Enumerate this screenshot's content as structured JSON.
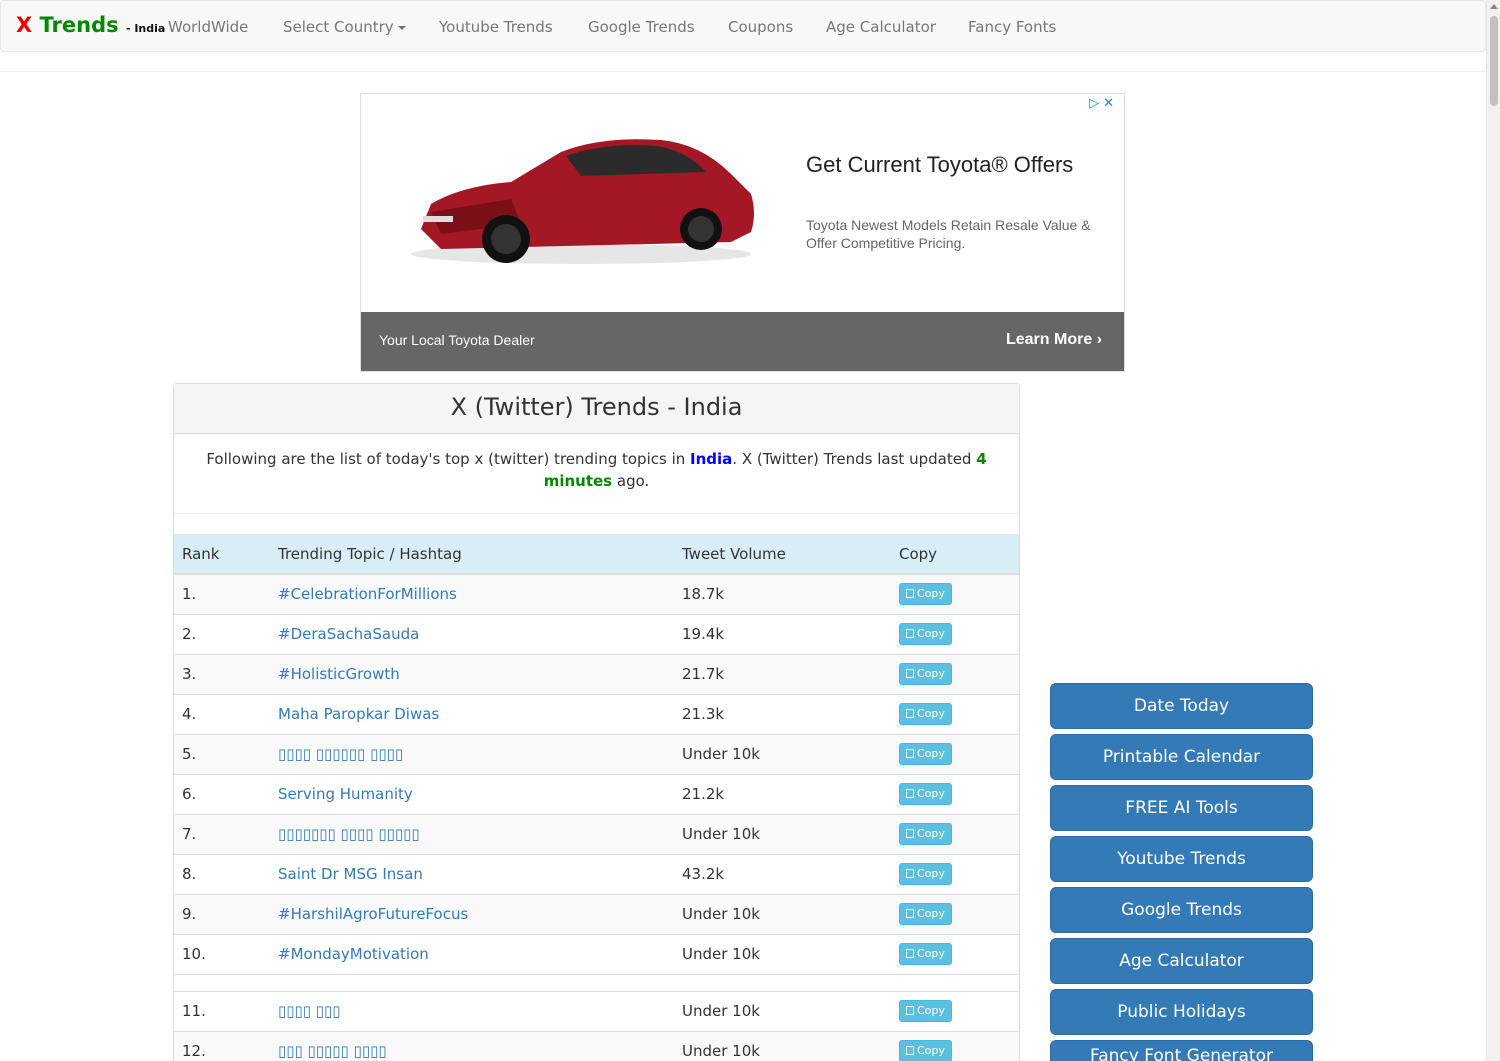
{
  "navbar": {
    "brand_x": "X",
    "brand_trends": "Trends",
    "brand_country": "- India",
    "items": [
      "WorldWide",
      "Select Country",
      "Youtube Trends",
      "Google Trends",
      "Coupons",
      "Age Calculator",
      "Fancy Fonts"
    ]
  },
  "ad": {
    "title": "Get Current Toyota® Offers",
    "description": "Toyota Newest Models Retain Resale Value & Offer Competitive Pricing.",
    "dealer": "Your Local Toyota Dealer",
    "cta": "Learn More"
  },
  "panel": {
    "title": "X (Twitter) Trends - India",
    "desc_before": "Following are the list of today's top x (twitter) trending topics in ",
    "desc_country": "India",
    "desc_middle": ". X (Twitter) Trends last updated ",
    "desc_time": "4 minutes",
    "desc_after": " ago."
  },
  "table": {
    "headers": [
      "Rank",
      "Trending Topic / Hashtag",
      "Tweet Volume",
      "Copy"
    ],
    "copy_label": "Copy",
    "rows": [
      {
        "rank": "1.",
        "topic": "#CelebrationForMillions",
        "volume": "18.7k"
      },
      {
        "rank": "2.",
        "topic": "#DeraSachaSauda",
        "volume": "19.4k"
      },
      {
        "rank": "3.",
        "topic": "#HolisticGrowth",
        "volume": "21.7k"
      },
      {
        "rank": "4.",
        "topic": "Maha Paropkar Diwas",
        "volume": "21.3k"
      },
      {
        "rank": "5.",
        "topic": "▯▯▯▯ ▯▯▯▯▯▯ ▯▯▯▯",
        "volume": "Under 10k"
      },
      {
        "rank": "6.",
        "topic": "Serving Humanity",
        "volume": "21.2k"
      },
      {
        "rank": "7.",
        "topic": "▯▯▯▯▯▯▯ ▯▯▯▯ ▯▯▯▯▯",
        "volume": "Under 10k"
      },
      {
        "rank": "8.",
        "topic": "Saint Dr MSG Insan",
        "volume": "43.2k"
      },
      {
        "rank": "9.",
        "topic": "#HarshilAgroFutureFocus",
        "volume": "Under 10k"
      },
      {
        "rank": "10.",
        "topic": "#MondayMotivation",
        "volume": "Under 10k"
      },
      {
        "rank": "11.",
        "topic": "▯▯▯▯ ▯▯▯",
        "volume": "Under 10k"
      },
      {
        "rank": "12.",
        "topic": "▯▯▯ ▯▯▯▯▯ ▯▯▯▯",
        "volume": "Under 10k"
      }
    ]
  },
  "sidebar": {
    "buttons": [
      "Date Today",
      "Printable Calendar",
      "FREE AI Tools",
      "Youtube Trends",
      "Google Trends",
      "Age Calculator",
      "Public Holidays",
      "Fancy Font Generator"
    ]
  },
  "colors": {
    "brand_x": "#ee0000",
    "brand_trends": "#008800",
    "link": "#337ab7",
    "header_bg": "#d9edf7",
    "copy_btn": "#5bc0de",
    "side_btn": "#337ab7"
  }
}
